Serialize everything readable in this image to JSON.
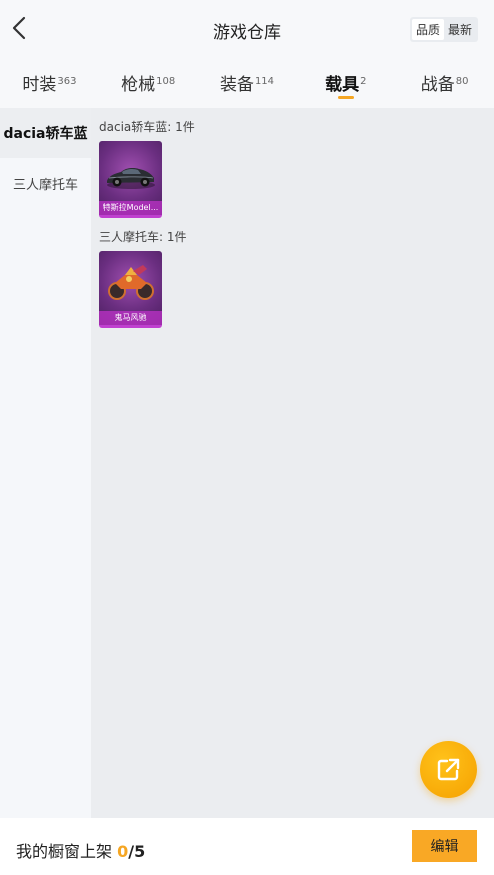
{
  "header": {
    "title": "游戏仓库",
    "sort_options": [
      "品质",
      "最新"
    ],
    "selected_sort": "品质"
  },
  "tabs": [
    {
      "label": "时装",
      "count": "363"
    },
    {
      "label": "枪械",
      "count": "108"
    },
    {
      "label": "装备",
      "count": "114"
    },
    {
      "label": "载具",
      "count": "2",
      "active": true
    },
    {
      "label": "战备",
      "count": "80"
    }
  ],
  "sidebar": {
    "items": [
      "dacia轿车蓝",
      "三人摩托车"
    ],
    "active": "dacia轿车蓝"
  },
  "groups": [
    {
      "title": "dacia轿车蓝: 1件",
      "items": [
        {
          "name": "特斯拉Model..."
        }
      ]
    },
    {
      "title": "三人摩托车: 1件",
      "items": [
        {
          "name": "鬼马风驰"
        }
      ]
    }
  ],
  "footer": {
    "shelf_label": "我的橱窗上架",
    "shelf_current": "0",
    "shelf_total": "/5",
    "edit_label": "编辑"
  },
  "colors": {
    "accent": "#f5a623",
    "card": "#6a2e80"
  },
  "icons": {
    "back": "chevron-left-icon",
    "share": "share-external-icon"
  }
}
